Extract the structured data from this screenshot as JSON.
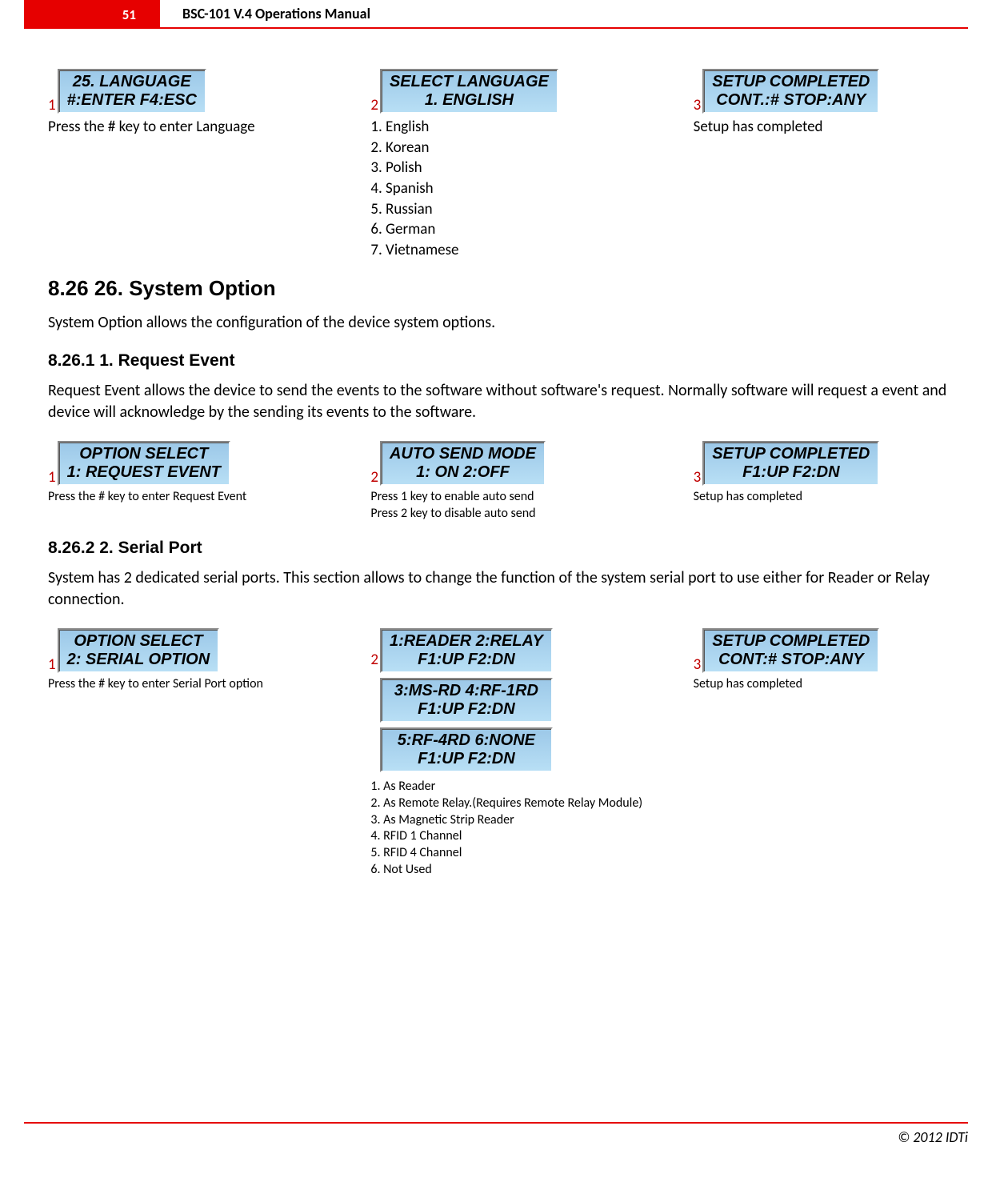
{
  "header": {
    "page_number": "51",
    "title": "BSC-101 V.4 Operations Manual"
  },
  "section_language": {
    "steps": [
      {
        "num": "1",
        "lcd": [
          "25. LANGUAGE",
          "#:ENTER  F4:ESC"
        ],
        "caption": "Press the # key to enter Language"
      },
      {
        "num": "2",
        "lcd": [
          "SELECT LANGUAGE",
          "1. ENGLISH"
        ],
        "caption_lines": [
          "1. English",
          "2. Korean",
          "3. Polish",
          "4. Spanish",
          "5. Russian",
          "6. German",
          "7. Vietnamese"
        ]
      },
      {
        "num": "3",
        "lcd": [
          "SETUP COMPLETED",
          "CONT.:#  STOP:ANY"
        ],
        "caption": "Setup has completed"
      }
    ]
  },
  "heading_8_26": "8.26    26. System Option",
  "para_8_26": "System Option allows the configuration of the device system options.",
  "heading_8_26_1": "8.26.1    1. Request Event",
  "para_8_26_1": "Request Event allows the device to send the events to the software without software's request. Normally software will request a event and device will acknowledge by the sending its events to the software.",
  "section_request_event": {
    "steps": [
      {
        "num": "1",
        "lcd": [
          "OPTION SELECT",
          "1: REQUEST EVENT"
        ],
        "caption": "Press the # key to enter Request Event"
      },
      {
        "num": "2",
        "lcd": [
          "AUTO SEND MODE",
          "1: ON    2:OFF"
        ],
        "caption_lines": [
          "Press 1 key to enable auto send",
          "Press 2 key to disable auto send"
        ]
      },
      {
        "num": "3",
        "lcd": [
          "SETUP COMPLETED",
          "F1:UP    F2:DN"
        ],
        "caption": "Setup has completed"
      }
    ]
  },
  "heading_8_26_2": "8.26.2    2. Serial Port",
  "para_8_26_2": "System has 2 dedicated serial ports. This section allows to change the function of the system serial port to use either for Reader or Relay connection.",
  "section_serial_port": {
    "steps": [
      {
        "num": "1",
        "lcd": [
          "OPTION SELECT",
          "2: SERIAL OPTION"
        ],
        "caption": "Press the # key to enter Serial Port option"
      },
      {
        "num": "2",
        "lcd_multi": [
          [
            "1:READER  2:RELAY",
            "F1:UP    F2:DN"
          ],
          [
            "3:MS-RD  4:RF-1RD",
            "F1:UP    F2:DN"
          ],
          [
            "5:RF-4RD  6:NONE",
            "F1:UP    F2:DN"
          ]
        ],
        "caption_lines": [
          "1. As Reader",
          "2. As Remote Relay.(Requires Remote Relay Module)",
          "3. As Magnetic Strip Reader",
          "4. RFID 1 Channel",
          "5. RFID 4 Channel",
          "6. Not Used"
        ]
      },
      {
        "num": "3",
        "lcd": [
          "SETUP COMPLETED",
          "CONT:#   STOP:ANY"
        ],
        "caption": "Setup has completed"
      }
    ]
  },
  "footer": "© 2012 IDTi"
}
